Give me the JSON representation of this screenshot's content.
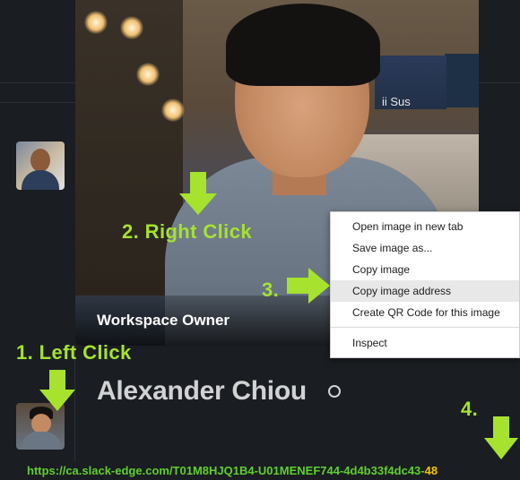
{
  "profile": {
    "role_label": "Workspace Owner",
    "name": "Alexander Chiou",
    "restaurant_sign": "ii Sus"
  },
  "context_menu": {
    "items": [
      {
        "label": "Open image in new tab"
      },
      {
        "label": "Save image as..."
      },
      {
        "label": "Copy image"
      },
      {
        "label": "Copy image address"
      },
      {
        "label": "Create QR Code for this image"
      },
      {
        "label": "Inspect"
      }
    ],
    "highlighted_index": 3
  },
  "annotations": {
    "step1": "1. Left Click",
    "step2": "2. Right Click",
    "step3": "3.",
    "step4": "4.",
    "url_main": "https://ca.slack-edge.com/T01M8HJQ1B4-U01MENEF744-4d4b33f4dc43-",
    "url_tail": "48",
    "accent_color": "#a6e22e"
  }
}
